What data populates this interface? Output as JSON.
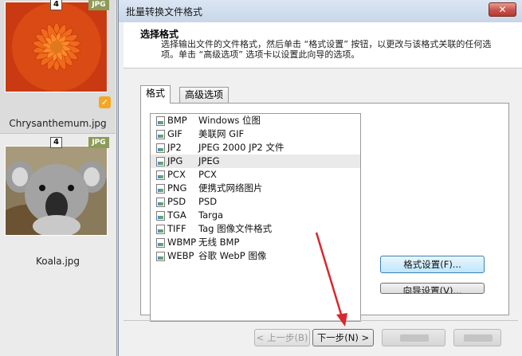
{
  "left_panel": {
    "items": [
      {
        "count": "4",
        "type": "JPG",
        "name": "Chrysanthemum.jpg",
        "checked": true
      },
      {
        "count": "4",
        "type": "JPG",
        "name": "Koala.jpg",
        "checked": false
      }
    ]
  },
  "dialog": {
    "title": "批量转换文件格式",
    "close_label": "✕",
    "header": {
      "title": "选择格式",
      "description": "选择输出文件的文件格式，然后单击 “格式设置” 按钮，以更改与该格式关联的任何选项。单击 “高级选项” 选项卡以设置此向导的选项。"
    },
    "tabs": [
      {
        "label": "格式",
        "active": true
      },
      {
        "label": "高级选项",
        "active": false
      }
    ],
    "formats": [
      {
        "code": "BMP",
        "desc": "Windows 位图"
      },
      {
        "code": "GIF",
        "desc": "美联网 GIF"
      },
      {
        "code": "JP2",
        "desc": "JPEG 2000 JP2 文件"
      },
      {
        "code": "JPG",
        "desc": "JPEG",
        "selected": true
      },
      {
        "code": "PCX",
        "desc": "PCX"
      },
      {
        "code": "PNG",
        "desc": "便携式网络图片"
      },
      {
        "code": "PSD",
        "desc": "PSD"
      },
      {
        "code": "TGA",
        "desc": "Targa"
      },
      {
        "code": "TIFF",
        "desc": "Tag 图像文件格式"
      },
      {
        "code": "WBMP",
        "desc": "无线 BMP"
      },
      {
        "code": "WEBP",
        "desc": "谷歌 WebP 图像"
      }
    ],
    "buttons": {
      "format_settings": "格式设置(F)...",
      "wizard_settings": "向导设置(V)...",
      "prev": "< 上一步(B)",
      "next": "下一步(N) >"
    }
  },
  "colors": {
    "accent": "#3c7fb1",
    "annotation_arrow": "#d8282e",
    "type_badge": "#8d9b5a",
    "check_badge": "#f5a623"
  }
}
